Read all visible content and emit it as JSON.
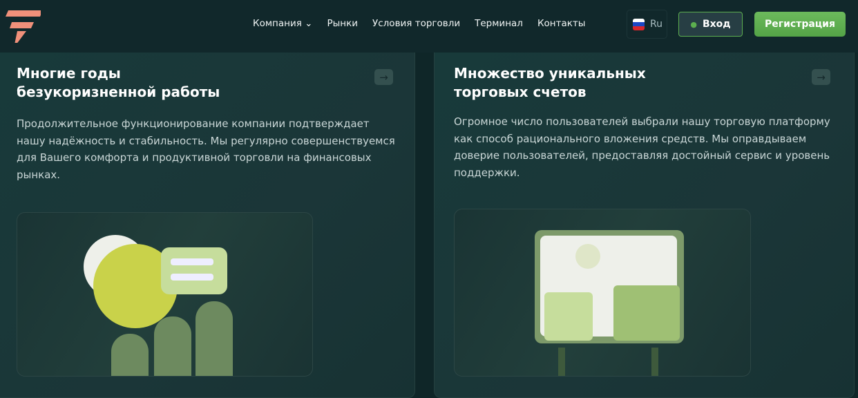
{
  "header": {
    "nav": [
      "Компания",
      "Рынки",
      "Условия торговли",
      "Терминал",
      "Контакты"
    ],
    "language": "Ru",
    "login": "Вход",
    "register": "Регистрация",
    "accent": "#5cae4f",
    "logo_color": "#f0907a"
  },
  "cards": [
    {
      "title_line1": "Многие годы",
      "title_line2": "безукоризненной работы",
      "text": "Продолжительное функционирование компании подтверждает нашу надёжность и стабильность. Мы регулярно совершенствуемся для Вашего комфорта и продуктивной торговли на финансовых рынках."
    },
    {
      "title_line1": "Множество уникальных",
      "title_line2": "торговых счетов",
      "text": "Огромное число пользователей выбрали нашу торговую платформу как способ рационального вложения средств. Мы оправдываем доверие пользователей, предоставляя достойный сервис и уровень поддержки."
    }
  ]
}
